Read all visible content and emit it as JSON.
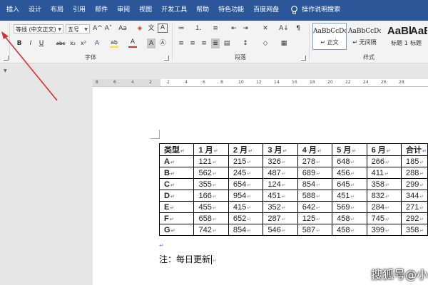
{
  "tabs": [
    "插入",
    "设计",
    "布局",
    "引用",
    "邮件",
    "审阅",
    "视图",
    "开发工具",
    "帮助",
    "特色功能",
    "百度网盘"
  ],
  "tell_me": "操作说明搜索",
  "font_group": {
    "font_name": "等线 (中文正文)",
    "font_size": "五号",
    "label": "字体",
    "row1_icons": [
      "A^",
      "A˅",
      "Aa",
      "◈",
      "文",
      "A"
    ],
    "row2_icons": [
      "B",
      "I",
      "U",
      "abc",
      "x₂",
      "x²",
      "A",
      "ab",
      "A",
      "A",
      "Ⓐ"
    ]
  },
  "paragraph_group": {
    "label": "段落",
    "row1_icons": [
      "≔",
      "⒈",
      "≡",
      "⇤",
      "⇥",
      "✕",
      "A↓",
      "¶"
    ],
    "row2_icons": [
      "≡",
      "≡",
      "≡",
      "≣",
      "▤",
      "↕",
      "◇",
      "▦"
    ]
  },
  "styles_group": {
    "label": "样式",
    "items": [
      {
        "sample": "AaBbCcDc",
        "name": "↵ 正文"
      },
      {
        "sample": "AaBbCcDc",
        "name": "↵ 无间隔"
      },
      {
        "sample": "AaBl",
        "name": "标题 1"
      },
      {
        "sample": "AaE",
        "name": "标题"
      }
    ]
  },
  "ruler": {
    "numbers": [
      "8",
      "6",
      "4",
      "2",
      "2",
      "4",
      "6",
      "8",
      "10",
      "12",
      "14",
      "16",
      "18",
      "20",
      "22",
      "24",
      "26",
      "28"
    ]
  },
  "table": {
    "headers": [
      "类型",
      "1 月",
      "2 月",
      "3 月",
      "4 月",
      "5 月",
      "6 月",
      "合计"
    ],
    "rows": [
      [
        "A",
        "121",
        "215",
        "326",
        "278",
        "648",
        "266",
        "185"
      ],
      [
        "B",
        "562",
        "245",
        "487",
        "689",
        "456",
        "411",
        "288"
      ],
      [
        "C",
        "355",
        "654",
        "124",
        "854",
        "645",
        "358",
        "299"
      ],
      [
        "D",
        "166",
        "954",
        "451",
        "588",
        "451",
        "832",
        "344"
      ],
      [
        "E",
        "455",
        "415",
        "352",
        "642",
        "569",
        "284",
        "271"
      ],
      [
        "F",
        "658",
        "652",
        "287",
        "125",
        "458",
        "745",
        "292"
      ],
      [
        "G",
        "742",
        "854",
        "546",
        "587",
        "458",
        "399",
        "358"
      ]
    ],
    "return_mark": "↵"
  },
  "note": "注：每日更新",
  "watermark": "搜狐号@小",
  "colors": {
    "ribbon_tab_bg": "#2b579a",
    "ribbon_bg": "#f3f3f3",
    "workarea_bg": "#e6e6e6",
    "arrow": "#d9302b",
    "mark": "#6b8fd6"
  },
  "icons": {
    "tell_me": "lightbulb-icon",
    "collapse": "chevron-icon",
    "annotation": "red-arrow-icon"
  }
}
